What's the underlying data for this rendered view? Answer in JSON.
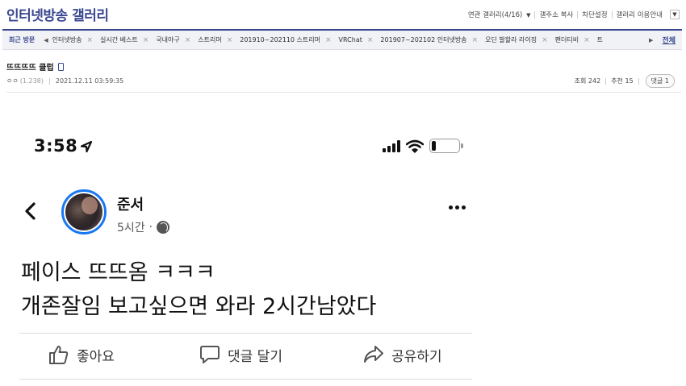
{
  "header": {
    "gallery_title": "인터넷방송 갤러리",
    "links": [
      {
        "label": "연관 갤러리(4/16)",
        "caret": "▼"
      },
      {
        "label": "갤주소 복사"
      },
      {
        "label": "차단설정"
      },
      {
        "label": "갤러리 이용안내"
      }
    ],
    "dropdown_glyph": "▼"
  },
  "recent": {
    "label": "최근 방문",
    "prev_arrow": "◀",
    "next_arrow": "▶",
    "close_glyph": "×",
    "items": [
      "인터넷방송",
      "실시간 베스트",
      "국내야구",
      "스트리머",
      "201910~202110 스트리머",
      "VRChat",
      "201907~202102 인터넷방송",
      "오딘 발할라 라이징",
      "팬더티비",
      "트"
    ],
    "all_label": "전체"
  },
  "post": {
    "title": "뜨뜨뜨뜨 클럽",
    "author": "ㅇㅇ",
    "ip": "(1.238)",
    "datetime": "2021.12.11 03:59:35",
    "views_label": "조회 242",
    "recommends_label": "추천 15",
    "comments_label": "댓글 1"
  },
  "facebook": {
    "status_time": "3:58",
    "author_name": "준서",
    "time_ago": "5시간",
    "dot": "·",
    "text_line1": "페이스 뜨뜨옴 ㅋㅋㅋ",
    "text_line2": "개존잘임 보고싶으면 와라 2시간남았다",
    "actions": {
      "like": "좋아요",
      "comment": "댓글 달기",
      "share": "공유하기"
    },
    "icons": {
      "back": "chevron-left-icon",
      "location": "location-arrow-icon",
      "signal": "signal-icon",
      "wifi": "wifi-icon",
      "battery": "battery-icon",
      "more": "more-icon",
      "globe": "globe-icon",
      "like": "thumbs-up-icon",
      "comment": "comment-icon",
      "share": "share-icon"
    },
    "colors": {
      "avatar_ring": "#1877f2"
    }
  },
  "colors": {
    "brand": "#3b4890"
  }
}
